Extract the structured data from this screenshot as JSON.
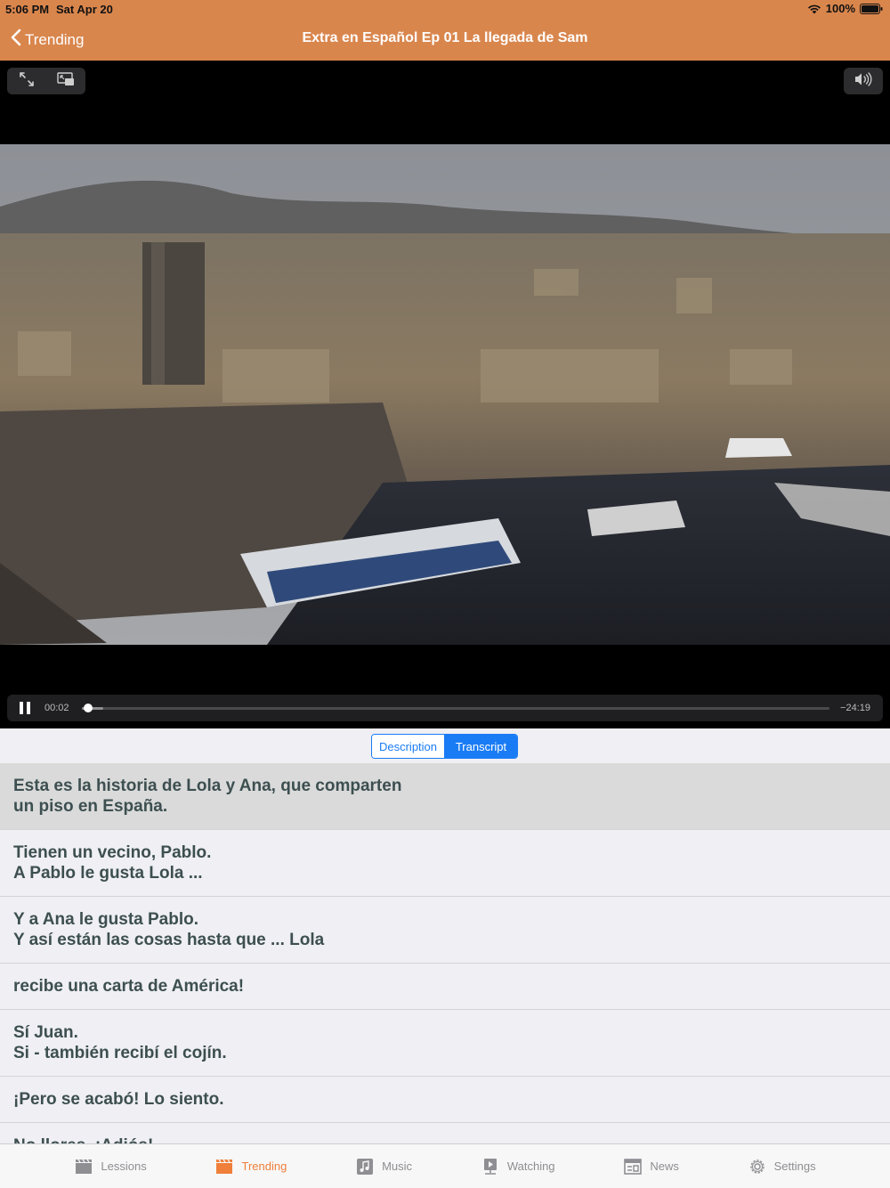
{
  "status": {
    "time": "5:06 PM",
    "date": "Sat Apr 20",
    "battery": "100%"
  },
  "nav": {
    "back_label": "Trending",
    "title": "Extra en Español Ep 01 La llegada de Sam"
  },
  "player": {
    "elapsed": "00:02",
    "remaining": "−24:19",
    "progress": 0.001
  },
  "segments": {
    "description": "Description",
    "transcript": "Transcript",
    "selected": "transcript"
  },
  "transcript": [
    {
      "lines": [
        "Esta es la historia de Lola y Ana, que comparten",
        "un piso en España."
      ],
      "active": true
    },
    {
      "lines": [
        "Tienen un vecino, Pablo.",
        "A Pablo le gusta Lola ..."
      ]
    },
    {
      "lines": [
        "Y a Ana le gusta Pablo.",
        "Y así están las cosas hasta que ... Lola"
      ]
    },
    {
      "lines": [
        "recibe una carta de América!"
      ]
    },
    {
      "lines": [
        "Sí Juan.",
        "Si - también recibí el cojín."
      ]
    },
    {
      "lines": [
        "¡Pero se acabó! Lo siento."
      ]
    },
    {
      "lines": [
        "No llores. ¡Adiós!"
      ]
    }
  ],
  "tabs": [
    {
      "label": "Lessions",
      "icon": "clapperboard-icon"
    },
    {
      "label": "Trending",
      "icon": "clapperboard-icon",
      "active": true
    },
    {
      "label": "Music",
      "icon": "music-note-icon"
    },
    {
      "label": "Watching",
      "icon": "video-play-icon"
    },
    {
      "label": "News",
      "icon": "newspaper-icon"
    },
    {
      "label": "Settings",
      "icon": "gear-icon"
    }
  ],
  "colors": {
    "header": "#d9864d",
    "accent": "#1a7cf5",
    "tab_active": "#ef7f3a"
  }
}
